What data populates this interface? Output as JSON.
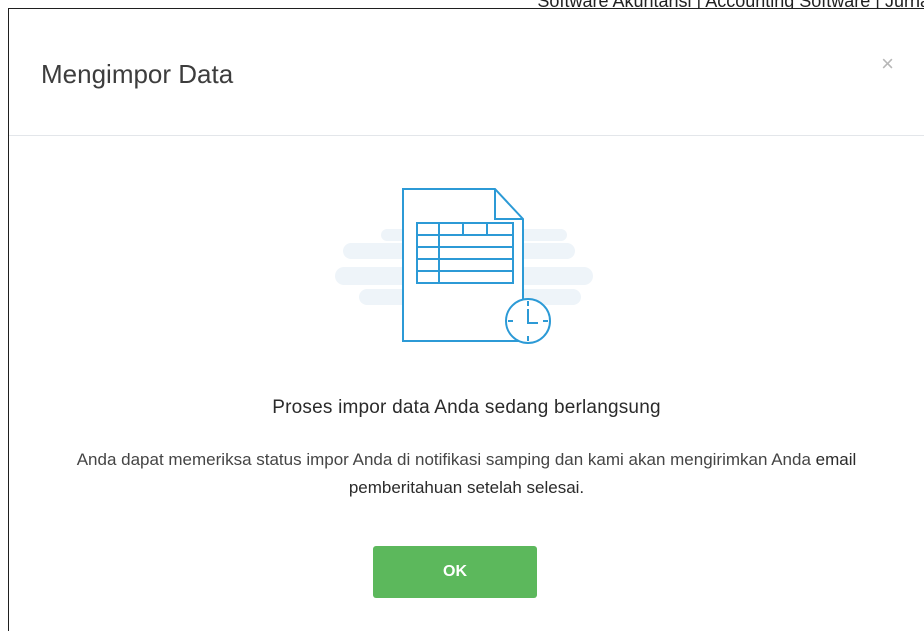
{
  "background": {
    "title": "Software Akuntansi | Accounting Software | Jurnal"
  },
  "dialog": {
    "title": "Mengimpor Data",
    "close_label": "×",
    "headline": "Proses impor data Anda sedang berlangsung",
    "description_part1": "Anda dapat memeriksa status impor Anda di notifikasi samping dan kami akan mengirimkan Anda ",
    "description_part2": "email pemberitahuan setelah selesai.",
    "ok_label": "OK",
    "illustration_icon": "spreadsheet-file-clock-icon"
  },
  "colors": {
    "accent_green": "#5cb85c",
    "icon_blue": "#2c9ad6",
    "cloud_bg": "#eef4f9"
  }
}
